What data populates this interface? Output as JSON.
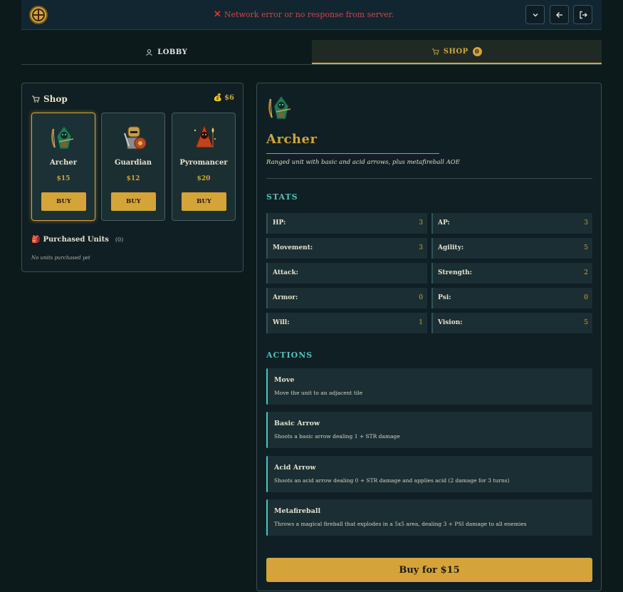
{
  "topbar": {
    "network_error": "Network error or no response from server."
  },
  "tabs": [
    {
      "label": "LOBBY"
    },
    {
      "label": "SHOP",
      "badge": "0"
    }
  ],
  "shop": {
    "title": "Shop",
    "gold": "$6",
    "units": [
      {
        "name": "Archer",
        "price": "$15",
        "buy": "BUY"
      },
      {
        "name": "Guardian",
        "price": "$12",
        "buy": "BUY"
      },
      {
        "name": "Pyromancer",
        "price": "$20",
        "buy": "BUY"
      }
    ],
    "purchased_title": "Purchased Units",
    "purchased_count": "(0)",
    "empty_text": "No units purchased yet"
  },
  "detail": {
    "name": "Archer",
    "description": "Ranged unit with basic and acid arrows, plus metafireball AOE",
    "stats_title": "STATS",
    "stats": [
      {
        "label": "HP:",
        "value": "3"
      },
      {
        "label": "AP:",
        "value": "3"
      },
      {
        "label": "Movement:",
        "value": "3"
      },
      {
        "label": "Agility:",
        "value": "5"
      },
      {
        "label": "Attack:",
        "value": ""
      },
      {
        "label": "Strength:",
        "value": "2"
      },
      {
        "label": "Armor:",
        "value": "0"
      },
      {
        "label": "Psi:",
        "value": "0"
      },
      {
        "label": "Will:",
        "value": "1"
      },
      {
        "label": "Vision:",
        "value": "5"
      }
    ],
    "actions_title": "ACTIONS",
    "actions": [
      {
        "name": "Move",
        "desc": "Move the unit to an adjacent tile"
      },
      {
        "name": "Basic Arrow",
        "desc": "Shoots a basic arrow dealing 1 + STR damage"
      },
      {
        "name": "Acid Arrow",
        "desc": "Shoots an acid arrow dealing 0 + STR damage and applies acid (2 damage for 3 turns)"
      },
      {
        "name": "Metafireball",
        "desc": "Throws a magical fireball that explodes in a 5x5 area, dealing 3 + PSI damage to all enemies"
      }
    ],
    "buy_label": "Buy for $15"
  }
}
